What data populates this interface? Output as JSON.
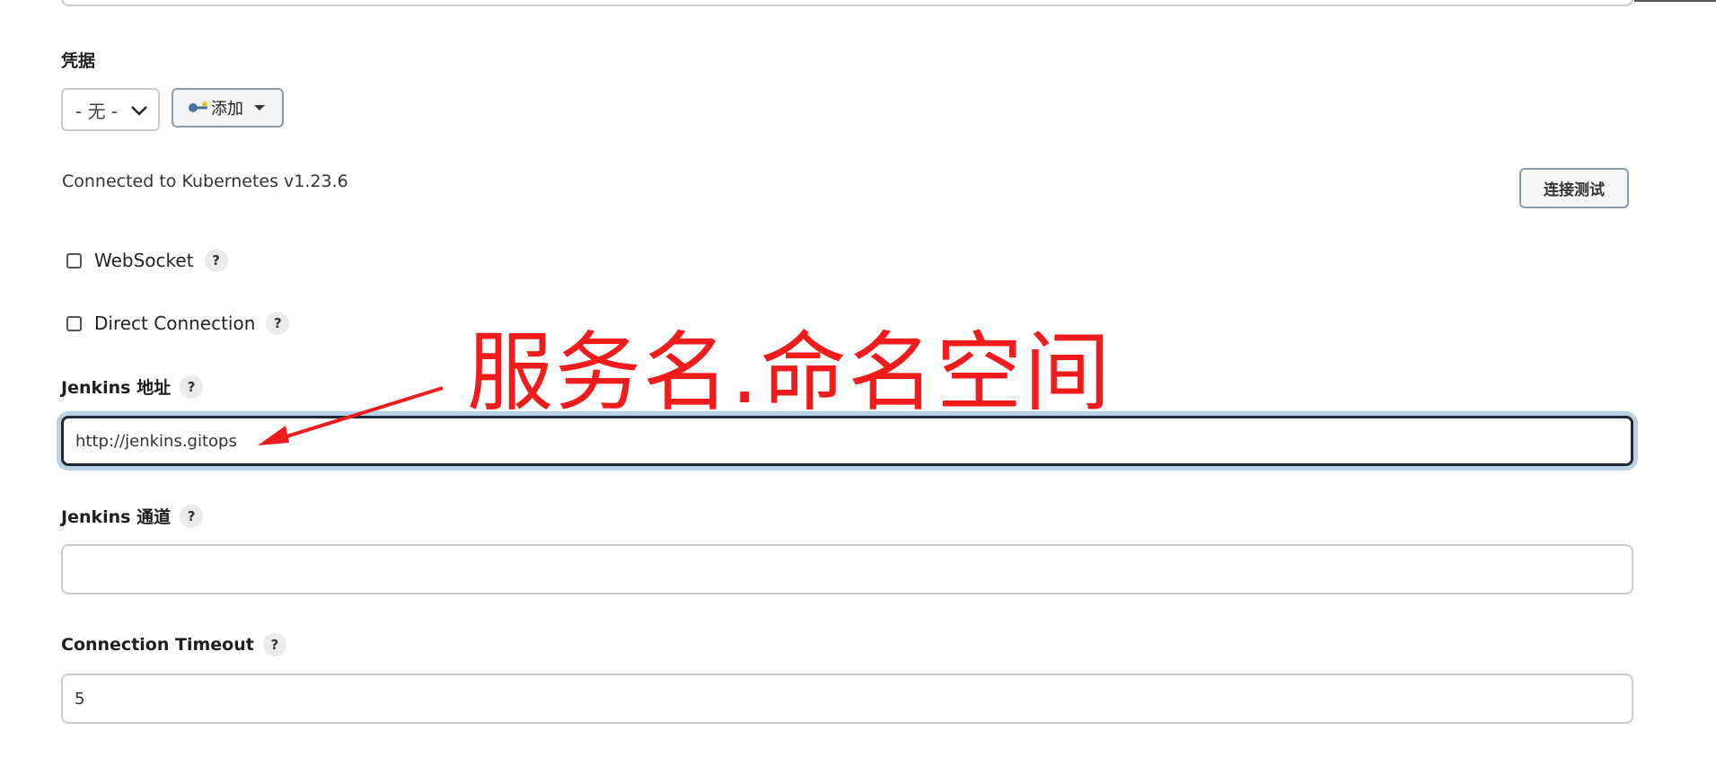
{
  "credentials": {
    "label": "凭据",
    "select_value": "- 无 -",
    "add_button": "添加"
  },
  "connection": {
    "status_text": "Connected to Kubernetes v1.23.6",
    "test_button": "连接测试"
  },
  "options": {
    "websocket_label": "WebSocket",
    "direct_connection_label": "Direct Connection",
    "help_glyph": "?"
  },
  "jenkins_url": {
    "label": "Jenkins 地址",
    "value": "http://jenkins.gitops"
  },
  "jenkins_tunnel": {
    "label": "Jenkins 通道",
    "value": ""
  },
  "connection_timeout": {
    "label": "Connection Timeout",
    "value": "5"
  },
  "annotation": {
    "text": "服务名.命名空间",
    "color": "#f01c1c"
  },
  "colors": {
    "focus_ring": "#b9d3e6",
    "border": "#c7ccd1"
  }
}
